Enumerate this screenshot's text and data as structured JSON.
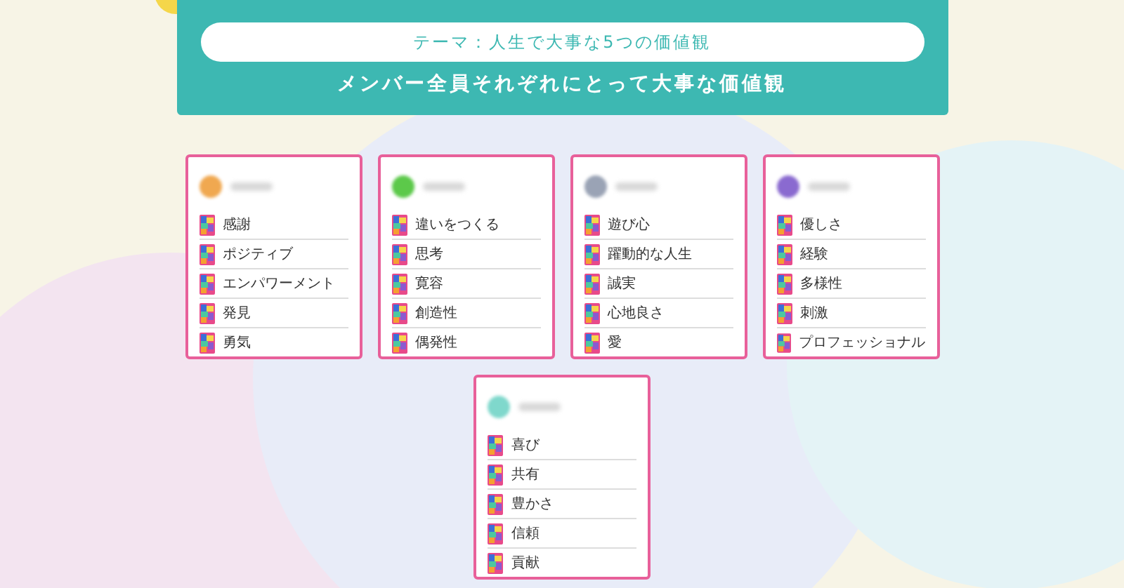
{
  "header": {
    "theme": "テーマ：人生で大事な5つの価値観",
    "title": "メンバー全員それぞれにとって大事な価値観"
  },
  "members": [
    {
      "color": "#f0a850",
      "values": [
        "感謝",
        "ポジティブ",
        "エンパワーメント",
        "発見",
        "勇気"
      ]
    },
    {
      "color": "#5cc94a",
      "values": [
        "違いをつくる",
        "思考",
        "寛容",
        "創造性",
        "偶発性"
      ]
    },
    {
      "color": "#9aa3b5",
      "values": [
        "遊び心",
        "躍動的な人生",
        "誠実",
        "心地良さ",
        "愛"
      ]
    },
    {
      "color": "#8a6ad0",
      "values": [
        "優しさ",
        "経験",
        "多様性",
        "刺激",
        "プロフェッショナル"
      ]
    },
    {
      "color": "#7fd8cc",
      "values": [
        "喜び",
        "共有",
        "豊かさ",
        "信頼",
        "貢献"
      ]
    }
  ]
}
